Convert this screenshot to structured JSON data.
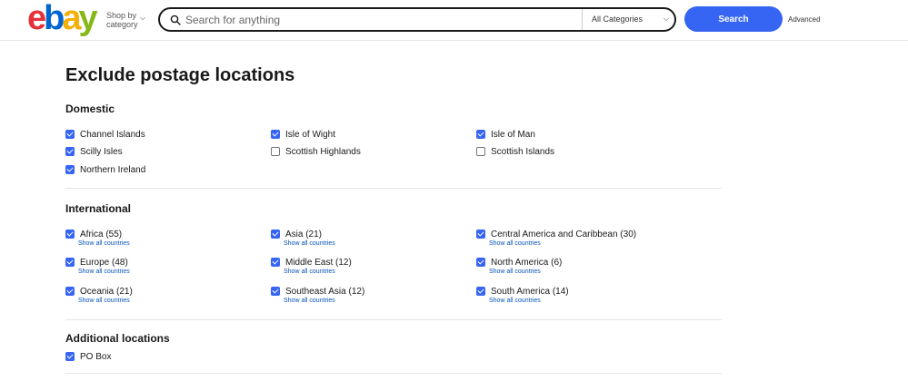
{
  "header": {
    "logo_letters": [
      "e",
      "b",
      "a",
      "y"
    ],
    "shop_by_line1": "Shop by",
    "shop_by_line2": "category",
    "search_placeholder": "Search for anything",
    "category_select": "All Categories",
    "search_button": "Search",
    "advanced_link": "Advanced"
  },
  "page_title": "Exclude postage locations",
  "domestic": {
    "title": "Domestic",
    "items": [
      {
        "label": "Channel Islands",
        "checked": true
      },
      {
        "label": "Isle of Wight",
        "checked": true
      },
      {
        "label": "Isle of Man",
        "checked": true
      },
      {
        "label": "Scilly Isles",
        "checked": true
      },
      {
        "label": "Scottish Highlands",
        "checked": false
      },
      {
        "label": "Scottish Islands",
        "checked": false
      },
      {
        "label": "Northern Ireland",
        "checked": true
      }
    ]
  },
  "international": {
    "title": "International",
    "show_all_label": "Show all countries",
    "items": [
      {
        "label": "Africa (55)",
        "checked": true
      },
      {
        "label": "Asia (21)",
        "checked": true
      },
      {
        "label": "Central America and Caribbean (30)",
        "checked": true
      },
      {
        "label": "Europe (48)",
        "checked": true
      },
      {
        "label": "Middle East (12)",
        "checked": true
      },
      {
        "label": "North America (6)",
        "checked": true
      },
      {
        "label": "Oceania (21)",
        "checked": true
      },
      {
        "label": "Southeast Asia (12)",
        "checked": true
      },
      {
        "label": "South America (14)",
        "checked": true
      }
    ]
  },
  "additional": {
    "title": "Additional locations",
    "items": [
      {
        "label": "PO Box",
        "checked": true
      }
    ]
  },
  "colors": {
    "accent": "#3665f3",
    "link": "#0654ba"
  }
}
